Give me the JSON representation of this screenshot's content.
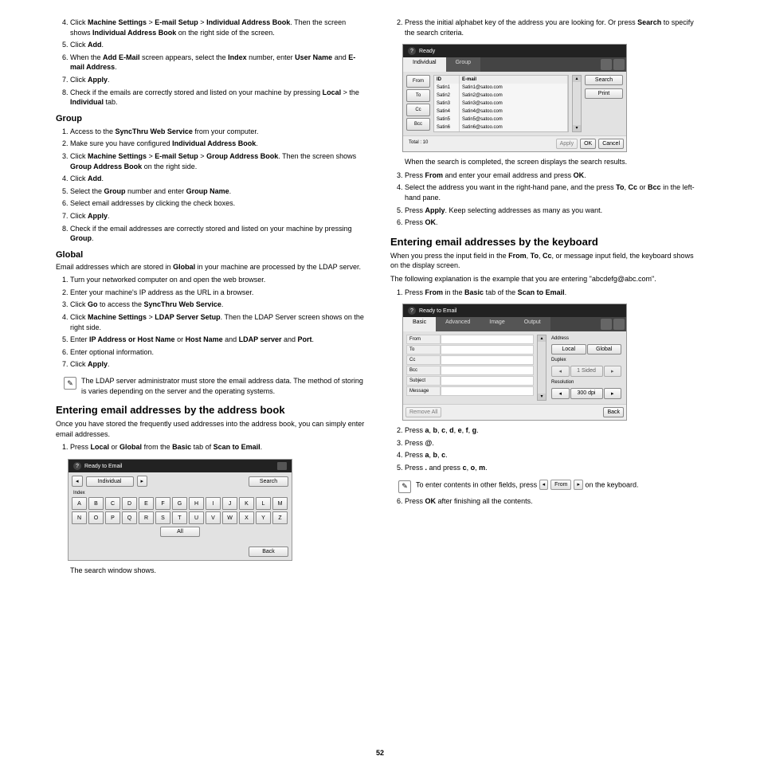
{
  "page_number": "52",
  "col1": {
    "step4_start": [
      {
        "t": true,
        "v": "4."
      }
    ],
    "step4": [
      {
        "t": false,
        "v": "Click "
      },
      {
        "t": true,
        "v": "Machine Settings"
      },
      {
        "t": false,
        "v": " > "
      },
      {
        "t": true,
        "v": "E-mail Setup"
      },
      {
        "t": false,
        "v": " > "
      },
      {
        "t": true,
        "v": "Individual Address Book"
      },
      {
        "t": false,
        "v": ". Then the screen shows "
      },
      {
        "t": true,
        "v": "Individual Address Book"
      },
      {
        "t": false,
        "v": " on the right side of the screen."
      }
    ],
    "step5": [
      {
        "t": false,
        "v": "Click "
      },
      {
        "t": true,
        "v": "Add"
      },
      {
        "t": false,
        "v": "."
      }
    ],
    "step6": [
      {
        "t": false,
        "v": "When the "
      },
      {
        "t": true,
        "v": "Add E-Mail"
      },
      {
        "t": false,
        "v": " screen appears, select the "
      },
      {
        "t": true,
        "v": "Index"
      },
      {
        "t": false,
        "v": " number, enter "
      },
      {
        "t": true,
        "v": "User Name"
      },
      {
        "t": false,
        "v": " and "
      },
      {
        "t": true,
        "v": "E-mail Address"
      },
      {
        "t": false,
        "v": "."
      }
    ],
    "step7": [
      {
        "t": false,
        "v": "Click "
      },
      {
        "t": true,
        "v": "Apply"
      },
      {
        "t": false,
        "v": "."
      }
    ],
    "step8": [
      {
        "t": false,
        "v": "Check if the emails are correctly stored and listed on your machine by pressing "
      },
      {
        "t": true,
        "v": "Local"
      },
      {
        "t": false,
        "v": " > the "
      },
      {
        "t": true,
        "v": "Individual"
      },
      {
        "t": false,
        "v": " tab."
      }
    ],
    "group_h": "Group",
    "g1": [
      {
        "t": false,
        "v": "Access to the "
      },
      {
        "t": true,
        "v": "SyncThru Web Service"
      },
      {
        "t": false,
        "v": " from your computer."
      }
    ],
    "g2": [
      {
        "t": false,
        "v": "Make sure you have configured "
      },
      {
        "t": true,
        "v": "Individual Address Book"
      },
      {
        "t": false,
        "v": "."
      }
    ],
    "g3": [
      {
        "t": false,
        "v": "Click "
      },
      {
        "t": true,
        "v": "Machine Settings"
      },
      {
        "t": false,
        "v": " > "
      },
      {
        "t": true,
        "v": "E-mail Setup"
      },
      {
        "t": false,
        "v": " > "
      },
      {
        "t": true,
        "v": "Group Address Book"
      },
      {
        "t": false,
        "v": ". Then the screen shows "
      },
      {
        "t": true,
        "v": "Group Address Book"
      },
      {
        "t": false,
        "v": " on the right side."
      }
    ],
    "g4": [
      {
        "t": false,
        "v": "Click "
      },
      {
        "t": true,
        "v": "Add"
      },
      {
        "t": false,
        "v": "."
      }
    ],
    "g5": [
      {
        "t": false,
        "v": "Select the "
      },
      {
        "t": true,
        "v": "Group"
      },
      {
        "t": false,
        "v": " number and enter "
      },
      {
        "t": true,
        "v": "Group Name"
      },
      {
        "t": false,
        "v": "."
      }
    ],
    "g6": [
      {
        "t": false,
        "v": "Select email addresses by clicking the check boxes."
      }
    ],
    "g7": [
      {
        "t": false,
        "v": "Click "
      },
      {
        "t": true,
        "v": "Apply"
      },
      {
        "t": false,
        "v": "."
      }
    ],
    "g8": [
      {
        "t": false,
        "v": "Check if the email addresses are correctly stored and listed on your machine by pressing "
      },
      {
        "t": true,
        "v": "Group"
      },
      {
        "t": false,
        "v": "."
      }
    ],
    "global_h": "Global",
    "global_intro": [
      {
        "t": false,
        "v": "Email addresses which are stored in "
      },
      {
        "t": true,
        "v": "Global"
      },
      {
        "t": false,
        "v": " in your machine are processed by the LDAP server."
      }
    ],
    "gl1": [
      {
        "t": false,
        "v": "Turn your networked computer on and open the web browser."
      }
    ],
    "gl2": [
      {
        "t": false,
        "v": "Enter your machine's IP address as the URL in a browser."
      }
    ],
    "gl3": [
      {
        "t": false,
        "v": "Click "
      },
      {
        "t": true,
        "v": "Go"
      },
      {
        "t": false,
        "v": " to access the "
      },
      {
        "t": true,
        "v": "SyncThru Web Service"
      },
      {
        "t": false,
        "v": "."
      }
    ],
    "gl4": [
      {
        "t": false,
        "v": "Click "
      },
      {
        "t": true,
        "v": "Machine Settings"
      },
      {
        "t": false,
        "v": " > "
      },
      {
        "t": true,
        "v": "LDAP Server Setup"
      },
      {
        "t": false,
        "v": ". Then the LDAP Server screen shows on the right side."
      }
    ],
    "gl5": [
      {
        "t": false,
        "v": "Enter "
      },
      {
        "t": true,
        "v": "IP Address or Host Name"
      },
      {
        "t": false,
        "v": " or "
      },
      {
        "t": true,
        "v": "Host Name"
      },
      {
        "t": false,
        "v": " and "
      },
      {
        "t": true,
        "v": "LDAP server"
      },
      {
        "t": false,
        "v": " and "
      },
      {
        "t": true,
        "v": "Port"
      },
      {
        "t": false,
        "v": "."
      }
    ],
    "gl6": [
      {
        "t": false,
        "v": "Enter optional information."
      }
    ],
    "gl7": [
      {
        "t": false,
        "v": "Click "
      },
      {
        "t": true,
        "v": "Apply"
      },
      {
        "t": false,
        "v": "."
      }
    ],
    "note1": "The LDAP server administrator must store the email address data. The method of storing is varies depending on the server and the operating systems.",
    "ab_h": "Entering email addresses by the address book",
    "ab_intro": "Once you have stored the frequently used addresses into the address book, you can simply enter email addresses.",
    "ab1": [
      {
        "t": false,
        "v": "Press "
      },
      {
        "t": true,
        "v": "Local"
      },
      {
        "t": false,
        "v": " or "
      },
      {
        "t": true,
        "v": "Global"
      },
      {
        "t": false,
        "v": " from the "
      },
      {
        "t": true,
        "v": "Basic"
      },
      {
        "t": false,
        "v": " tab of "
      },
      {
        "t": true,
        "v": "Scan to Email"
      },
      {
        "t": false,
        "v": "."
      }
    ],
    "ab_after": "The search window shows."
  },
  "col2": {
    "s2": [
      {
        "t": false,
        "v": "Press the initial alphabet key of the address you are looking for. Or press "
      },
      {
        "t": true,
        "v": "Search"
      },
      {
        "t": false,
        "v": " to specify the search criteria."
      }
    ],
    "after_panel": "When the search is completed, the screen displays the search results.",
    "s3": [
      {
        "t": false,
        "v": "Press "
      },
      {
        "t": true,
        "v": "From"
      },
      {
        "t": false,
        "v": " and enter your email address and press "
      },
      {
        "t": true,
        "v": "OK"
      },
      {
        "t": false,
        "v": "."
      }
    ],
    "s4": [
      {
        "t": false,
        "v": "Select the address you want in the right-hand pane, and the press "
      },
      {
        "t": true,
        "v": "To"
      },
      {
        "t": false,
        "v": ", "
      },
      {
        "t": true,
        "v": "Cc"
      },
      {
        "t": false,
        "v": " or "
      },
      {
        "t": true,
        "v": "Bcc"
      },
      {
        "t": false,
        "v": " in the left-hand pane."
      }
    ],
    "s5": [
      {
        "t": false,
        "v": "Press "
      },
      {
        "t": true,
        "v": "Apply"
      },
      {
        "t": false,
        "v": ". Keep selecting addresses as many as you want."
      }
    ],
    "s6": [
      {
        "t": false,
        "v": "Press "
      },
      {
        "t": true,
        "v": "OK"
      },
      {
        "t": false,
        "v": "."
      }
    ],
    "kb_h": "Entering email addresses by the keyboard",
    "kb_p1": [
      {
        "t": false,
        "v": "When you press the input field in the "
      },
      {
        "t": true,
        "v": "From"
      },
      {
        "t": false,
        "v": ", "
      },
      {
        "t": true,
        "v": "To"
      },
      {
        "t": false,
        "v": ", "
      },
      {
        "t": true,
        "v": "Cc"
      },
      {
        "t": false,
        "v": ", or message input field, the keyboard shows on the display screen."
      }
    ],
    "kb_p2": "The following explanation is the example that you are entering \"abcdefg@abc.com\".",
    "kb1": [
      {
        "t": false,
        "v": "Press "
      },
      {
        "t": true,
        "v": "From"
      },
      {
        "t": false,
        "v": " in the "
      },
      {
        "t": true,
        "v": "Basic"
      },
      {
        "t": false,
        "v": " tab of the "
      },
      {
        "t": true,
        "v": "Scan to Email"
      },
      {
        "t": false,
        "v": "."
      }
    ],
    "kb2": [
      {
        "t": false,
        "v": "Press "
      },
      {
        "t": true,
        "v": "a"
      },
      {
        "t": false,
        "v": ", "
      },
      {
        "t": true,
        "v": "b"
      },
      {
        "t": false,
        "v": ", "
      },
      {
        "t": true,
        "v": "c"
      },
      {
        "t": false,
        "v": ", "
      },
      {
        "t": true,
        "v": "d"
      },
      {
        "t": false,
        "v": ", "
      },
      {
        "t": true,
        "v": "e"
      },
      {
        "t": false,
        "v": ", "
      },
      {
        "t": true,
        "v": "f"
      },
      {
        "t": false,
        "v": ", "
      },
      {
        "t": true,
        "v": "g"
      },
      {
        "t": false,
        "v": "."
      }
    ],
    "kb3": [
      {
        "t": false,
        "v": "Press "
      },
      {
        "t": true,
        "v": "@"
      },
      {
        "t": false,
        "v": "."
      }
    ],
    "kb4": [
      {
        "t": false,
        "v": "Press "
      },
      {
        "t": true,
        "v": "a"
      },
      {
        "t": false,
        "v": ", "
      },
      {
        "t": true,
        "v": "b"
      },
      {
        "t": false,
        "v": ", "
      },
      {
        "t": true,
        "v": "c"
      },
      {
        "t": false,
        "v": "."
      }
    ],
    "kb5": [
      {
        "t": false,
        "v": "Press "
      },
      {
        "t": true,
        "v": "."
      },
      {
        "t": false,
        "v": " and press "
      },
      {
        "t": true,
        "v": "c"
      },
      {
        "t": false,
        "v": ", "
      },
      {
        "t": true,
        "v": "o"
      },
      {
        "t": false,
        "v": ", "
      },
      {
        "t": true,
        "v": "m"
      },
      {
        "t": false,
        "v": "."
      }
    ],
    "note2_pre": "To enter contents in other fields, press ",
    "note2_btn_left": "◂",
    "note2_btn_mid": "From",
    "note2_btn_right": "▸",
    "note2_post": " on the keyboard.",
    "kb6": [
      {
        "t": false,
        "v": "Press "
      },
      {
        "t": true,
        "v": "OK"
      },
      {
        "t": false,
        "v": " after finishing all the contents."
      }
    ]
  },
  "panel_kb": {
    "title": "Ready to Email",
    "individual": "Individual",
    "arrow": "▸",
    "search": "Search",
    "index": "Index",
    "row1": [
      "A",
      "B",
      "C",
      "D",
      "E",
      "F",
      "G",
      "H",
      "I",
      "J",
      "K",
      "L",
      "M"
    ],
    "row2": [
      "N",
      "O",
      "P",
      "Q",
      "R",
      "S",
      "T",
      "U",
      "V",
      "W",
      "X",
      "Y",
      "Z"
    ],
    "all": "All",
    "back": "Back"
  },
  "panel_list": {
    "title": "Ready",
    "tabs": [
      "Individual",
      "Group"
    ],
    "side": [
      "From",
      "To",
      "Cc",
      "Bcc"
    ],
    "head": [
      "ID",
      "E-mail"
    ],
    "rows": [
      [
        "Satin1",
        "Satin1@satoo.com"
      ],
      [
        "Satin2",
        "Satin2@satoo.com"
      ],
      [
        "Satin3",
        "Satin3@satoo.com"
      ],
      [
        "Satin4",
        "Satin4@satoo.com"
      ],
      [
        "Satin5",
        "Satin5@satoo.com"
      ],
      [
        "Satin6",
        "Satin6@satoo.com"
      ]
    ],
    "search": "Search",
    "print": "Print",
    "total": "Total : 10",
    "apply": "Apply",
    "ok": "OK",
    "cancel": "Cancel"
  },
  "panel_email": {
    "title": "Ready to Email",
    "tabs": [
      "Basic",
      "Advanced",
      "Image",
      "Output"
    ],
    "fields": [
      "From",
      "To",
      "Cc",
      "Bcc",
      "Subject",
      "Message"
    ],
    "address": "Address",
    "local": "Local",
    "global": "Global",
    "duplex": "Duplex",
    "duplex_val": "1 Sided",
    "resolution": "Resolution",
    "res_val": "300 dpi",
    "remove": "Remove All",
    "back": "Back"
  }
}
